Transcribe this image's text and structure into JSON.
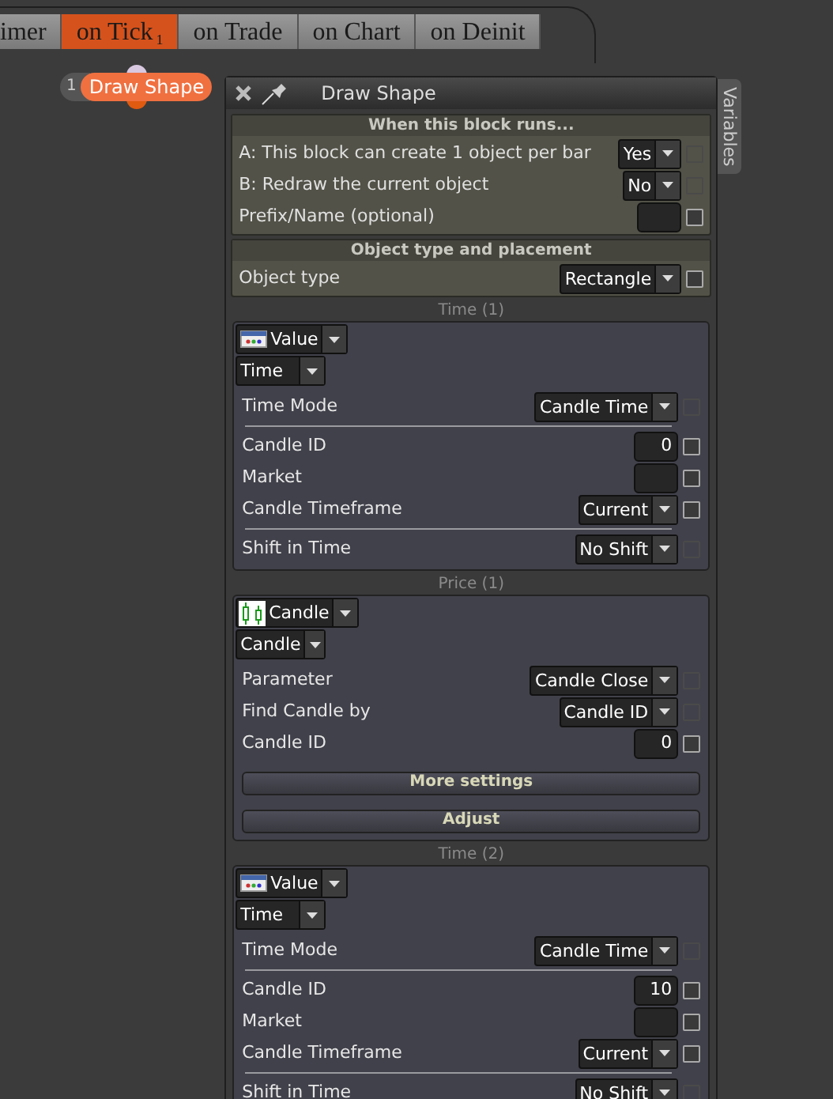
{
  "tabs": [
    {
      "label": "imer",
      "selected": false
    },
    {
      "label": "on Tick",
      "badge": "1",
      "selected": true
    },
    {
      "label": "on Trade",
      "selected": false
    },
    {
      "label": "on Chart",
      "selected": false
    },
    {
      "label": "on Deinit",
      "selected": false
    }
  ],
  "node": {
    "number": "1",
    "label": "Draw Shape"
  },
  "dialog": {
    "title": "Draw Shape",
    "side_tab": "Variables",
    "sections": [
      {
        "header": "When this block runs...",
        "rows": [
          {
            "label": "A: This block can create 1 object per bar",
            "kind": "select",
            "value": "Yes",
            "checkbox_disabled": true
          },
          {
            "label": "B: Redraw the current object",
            "kind": "select",
            "value": "No",
            "checkbox_disabled": true
          },
          {
            "label": "Prefix/Name (optional)",
            "kind": "input",
            "checkbox_disabled": false
          }
        ]
      },
      {
        "header": "Object type and placement",
        "rows": [
          {
            "label": "Object type",
            "kind": "select",
            "value": "Rectangle",
            "checkbox_disabled": false
          }
        ]
      }
    ],
    "groups": [
      {
        "title": "Time (1)",
        "source": {
          "kind": "value",
          "value": "Value"
        },
        "subtype": "Time",
        "rows": [
          {
            "label": "Time Mode",
            "kind": "select",
            "value": "Candle Time",
            "checkbox_disabled": true,
            "divider_after": true
          },
          {
            "label": "Candle ID",
            "kind": "input",
            "value": "0",
            "checkbox_disabled": false
          },
          {
            "label": "Market",
            "kind": "input",
            "checkbox_disabled": false
          },
          {
            "label": "Candle Timeframe",
            "kind": "select",
            "value": "Current",
            "checkbox_disabled": false,
            "divider_after": true
          },
          {
            "label": "Shift in Time",
            "kind": "select",
            "value": "No Shift",
            "checkbox_disabled": true
          }
        ]
      },
      {
        "title": "Price (1)",
        "source": {
          "kind": "candle",
          "value": "Candle"
        },
        "subtype": "Candle",
        "rows": [
          {
            "label": "Parameter",
            "kind": "select",
            "value": "Candle Close",
            "checkbox_disabled": true
          },
          {
            "label": "Find Candle by",
            "kind": "select",
            "value": "Candle ID",
            "checkbox_disabled": true
          },
          {
            "label": "Candle ID",
            "kind": "input",
            "value": "0",
            "checkbox_disabled": false
          }
        ],
        "buttons": [
          "More settings",
          "Adjust"
        ]
      },
      {
        "title": "Time (2)",
        "source": {
          "kind": "value",
          "value": "Value"
        },
        "subtype": "Time",
        "rows": [
          {
            "label": "Time Mode",
            "kind": "select",
            "value": "Candle Time",
            "checkbox_disabled": true,
            "divider_after": true
          },
          {
            "label": "Candle ID",
            "kind": "input",
            "value": "10",
            "checkbox_disabled": false
          },
          {
            "label": "Market",
            "kind": "input",
            "checkbox_disabled": false
          },
          {
            "label": "Candle Timeframe",
            "kind": "select",
            "value": "Current",
            "checkbox_disabled": false,
            "divider_after": true
          },
          {
            "label": "Shift in Time",
            "kind": "select",
            "value": "No Shift",
            "checkbox_disabled": true
          }
        ]
      }
    ]
  }
}
